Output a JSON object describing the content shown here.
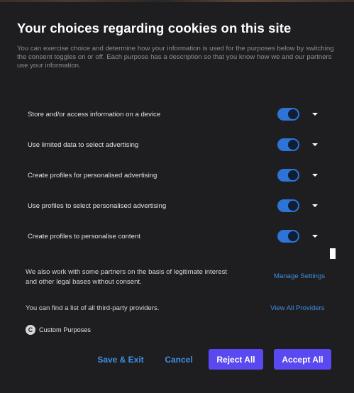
{
  "title": "Your choices regarding cookies on this site",
  "description": "You can exercise choice and determine how your information is used for the purposes below by switching the consent toggles on or off. Each purpose has a description so that you know how we and our partners use your information.",
  "purposes": [
    {
      "label": "Store and/or access information on a device",
      "enabled": true
    },
    {
      "label": "Use limited data to select advertising",
      "enabled": true
    },
    {
      "label": "Create profiles for personalised advertising",
      "enabled": true
    },
    {
      "label": "Use profiles to select personalised advertising",
      "enabled": true
    },
    {
      "label": "Create profiles to personalise content",
      "enabled": true
    }
  ],
  "legitimate_interest": {
    "text": "We also work with some partners on the basis of legitimate interest and other legal bases without consent.",
    "link": "Manage Settings"
  },
  "providers": {
    "text": "You can find a list of all third-party providers.",
    "link": "View All Providers"
  },
  "custom_purposes": {
    "icon_letter": "C",
    "label": "Custom Purposes"
  },
  "buttons": {
    "save_exit": "Save & Exit",
    "cancel": "Cancel",
    "reject_all": "Reject All",
    "accept_all": "Accept All"
  },
  "colors": {
    "background": "#1e1e20",
    "toggle_on": "#2d74d6",
    "link": "#3d8fe6",
    "primary_button": "#5a49f0"
  }
}
